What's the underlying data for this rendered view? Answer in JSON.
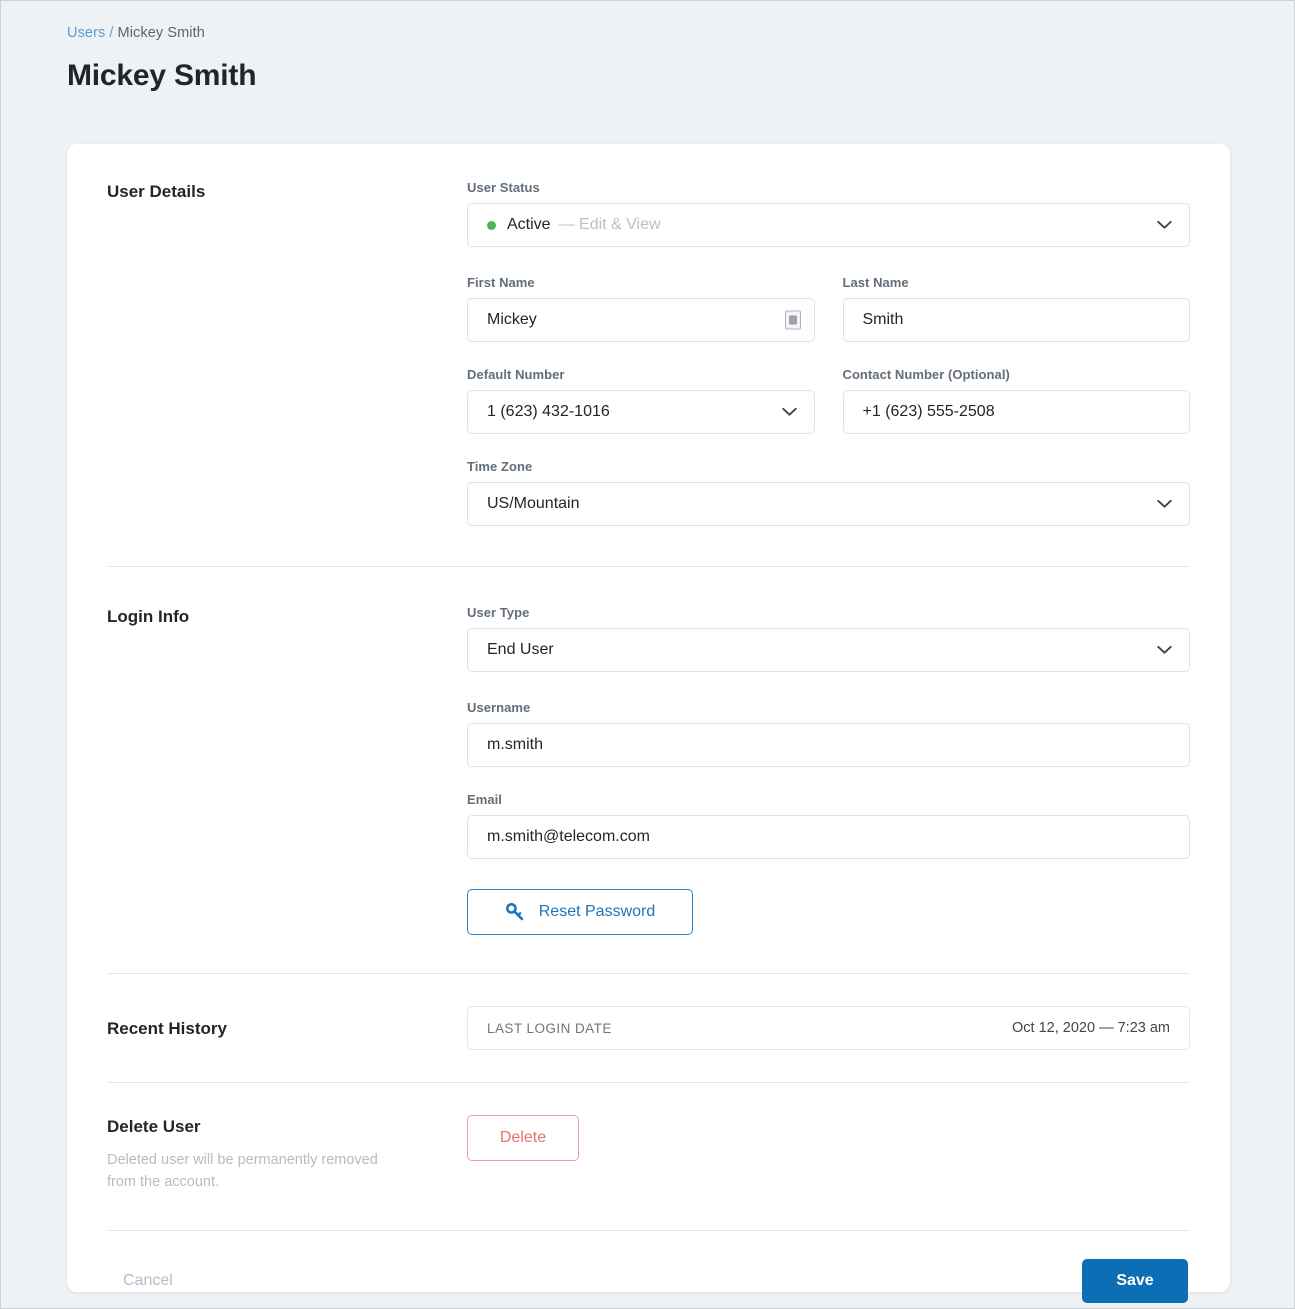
{
  "breadcrumb": {
    "link": "Users",
    "separator": "/",
    "current": "Mickey Smith"
  },
  "page_title": "Mickey Smith",
  "colors": {
    "page_background": "#eef2f5",
    "card_background": "#ffffff",
    "link_blue": "#5b9bd5",
    "primary_blue": "#0c6eb4",
    "reset_border_blue": "#2f84c4",
    "status_green": "#49b858",
    "danger_red": "#e8736a",
    "label_gray": "#636e79",
    "muted_gray": "#b4bcc4",
    "border_gray": "#dfe3e7"
  },
  "sections": {
    "user_details": {
      "title": "User Details",
      "user_status": {
        "label": "User Status",
        "value": "Active",
        "detail": "— Edit & View"
      },
      "first_name": {
        "label": "First Name",
        "value": "Mickey"
      },
      "last_name": {
        "label": "Last Name",
        "value": "Smith"
      },
      "default_number": {
        "label": "Default Number",
        "value": "1 (623) 432-1016"
      },
      "contact_number": {
        "label": "Contact Number (Optional)",
        "value": "+1 (623) 555-2508"
      },
      "time_zone": {
        "label": "Time Zone",
        "value": "US/Mountain"
      }
    },
    "login_info": {
      "title": "Login Info",
      "user_type": {
        "label": "User Type",
        "value": "End User"
      },
      "username": {
        "label": "Username",
        "value": "m.smith"
      },
      "email": {
        "label": "Email",
        "value": "m.smith@telecom.com"
      },
      "reset_password_label": "Reset Password"
    },
    "recent_history": {
      "title": "Recent History",
      "key": "LAST LOGIN DATE",
      "value": "Oct 12, 2020 — 7:23 am"
    },
    "delete_user": {
      "title": "Delete User",
      "description": "Deleted user will be permanently removed from the account.",
      "button_label": "Delete"
    }
  },
  "footer": {
    "cancel_label": "Cancel",
    "save_label": "Save"
  }
}
